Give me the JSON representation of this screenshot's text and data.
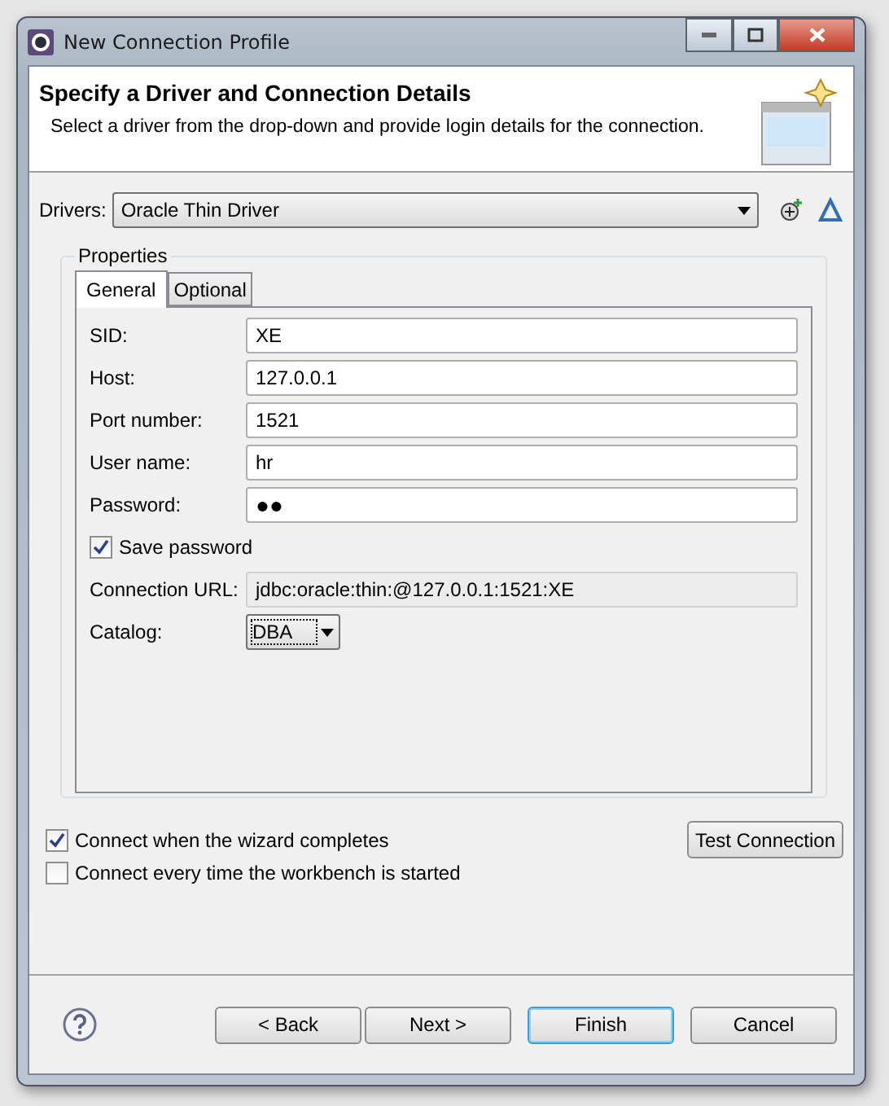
{
  "window": {
    "title": "New Connection Profile"
  },
  "header": {
    "title": "Specify a Driver and Connection Details",
    "description": "Select a driver from the drop-down and provide login details for the connection."
  },
  "drivers": {
    "label": "Drivers:",
    "value": "Oracle Thin Driver"
  },
  "properties": {
    "title": "Properties",
    "tabs": [
      {
        "label": "General",
        "selected": true
      },
      {
        "label": "Optional",
        "selected": false
      }
    ],
    "fields": [
      {
        "kind": "text",
        "label": "SID:",
        "value": "XE"
      },
      {
        "kind": "text",
        "label": "Host:",
        "value": "127.0.0.1"
      },
      {
        "kind": "text",
        "label": "Port number:",
        "value": "1521"
      },
      {
        "kind": "text",
        "label": "User name:",
        "value": "hr"
      },
      {
        "kind": "password",
        "label": "Password:",
        "value": "●●"
      },
      {
        "kind": "checkbox",
        "label": "Save password",
        "checked": true
      },
      {
        "kind": "readonly",
        "label": "Connection URL:",
        "value": "jdbc:oracle:thin:@127.0.0.1:1521:XE"
      },
      {
        "kind": "combo",
        "label": "Catalog:",
        "value": "DBA"
      }
    ]
  },
  "options": [
    {
      "label": "Connect when the wizard completes",
      "checked": true
    },
    {
      "label": "Connect every time the workbench is started",
      "checked": false
    }
  ],
  "test_button": "Test Connection",
  "buttons": [
    {
      "label": "< Back",
      "default": false
    },
    {
      "label": "Next >",
      "default": false
    },
    {
      "label": "Finish",
      "default": true
    },
    {
      "label": "Cancel",
      "default": false
    }
  ]
}
